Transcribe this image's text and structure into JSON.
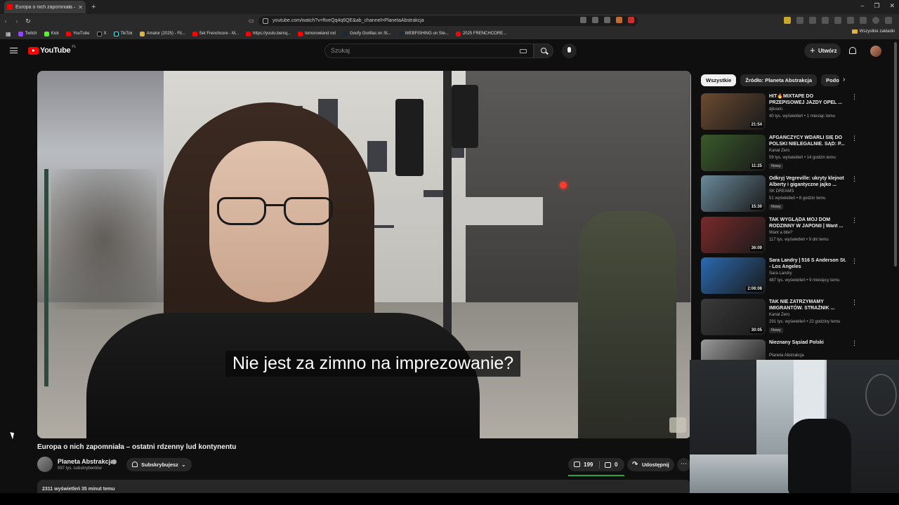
{
  "browser": {
    "tab_title": "Europa o nich zapomniała –",
    "url": "youtube.com/watch?v=ftveQq4q6QE&ab_channel=PlanetaAbstrakcja",
    "bookmarks": [
      "Twitch",
      "Kick",
      "YouTube",
      "X",
      "TikTok",
      "Amator (2025) - Fil...",
      "Set Frenchcore - M...",
      "https://youtu.be/xq...",
      "tomorowland nxt",
      "Goofy Gorillas on St...",
      "WEBFISHING on Ste...",
      "2025 FRENCHCORE..."
    ],
    "bookmarks_folder": "Wszystkie zakładki"
  },
  "header": {
    "logo_text": "YouTube",
    "logo_country": "PL",
    "search_placeholder": "Szukaj",
    "create_label": "Utwórz"
  },
  "video": {
    "subtitle": "Nie jest za zimno na imprezowanie?",
    "title": "Europa o nich zapomniała – ostatni rdzenny lud kontynentu",
    "channel_name": "Planeta Abstrakcja",
    "channel_subs": "597 tys. subskrybentów",
    "subscribe_label": "Subskrybujesz",
    "likes": "199",
    "dislikes": "0",
    "like_ratio": 1.0,
    "share_label": "Udostępnij",
    "description_preview": "2311 wyświetleń  35 minut temu"
  },
  "sidebar": {
    "chips": [
      "Wszystkie",
      "Źródło: Planeta Abstrakcja",
      "Podob"
    ],
    "recommendations": [
      {
        "title": "HIT🔥MIXTAPE DO PRZEPISOWEJ JAZDY OPEL ...",
        "channel": "djlusen",
        "meta": "40 tys. wyświetleń • 1 miesiąc temu",
        "duration": "21:54",
        "thumb": "#6b4a30",
        "badge": ""
      },
      {
        "title": "AFGAŃCZYCY WDARLI SIĘ DO POLSKI NIELEGALNIE. SĄD: P...",
        "channel": "Kanał Zero",
        "meta": "59 tys. wyświetleń • 14 godzin temu",
        "duration": "11:25",
        "thumb": "#3a5a2a",
        "badge": "Nowy"
      },
      {
        "title": "Odkryj Vegreville: ukryty klejnot Alberty i gigantyczne jajko ...",
        "channel": "SK DREAMS",
        "meta": "51 wyświetleń • 8 godzin temu",
        "duration": "15:30",
        "thumb": "#6a8a9a",
        "badge": "Nowy"
      },
      {
        "title": "TAK WYGLĄDA MÓJ DOM RODZINNY W JAPONII | Want ...",
        "channel": "Want a bite?",
        "meta": "117 tys. wyświetleń • 9 dni temu",
        "duration": "36:09",
        "thumb": "#7a2a2a",
        "badge": ""
      },
      {
        "title": "Sara Landry | 516 S Anderson St. - Los Angeles",
        "channel": "Sara Landry",
        "meta": "487 tys. wyświetleń • 9 miesięcy temu",
        "duration": "2:06:08",
        "thumb": "#2a6ab0",
        "badge": ""
      },
      {
        "title": "TAK NIE ZATRZYMAMY IMIGRANTÓW. STRAŻNIK ...",
        "channel": "Kanał Zero",
        "meta": "291 tys. wyświetleń • 22 godziny temu",
        "duration": "30:05",
        "thumb": "#3a3a3a",
        "badge": "Nowy"
      },
      {
        "title": "Nieznany Sąsiad Polski",
        "channel": "Planeta Abstrakcja",
        "meta": "609 tys. wyświetleń • 2 miesiące temu",
        "duration": "",
        "thumb": "#9a9a9a",
        "badge": ""
      }
    ]
  },
  "colors": {
    "accent": "#ff0000",
    "like_bar": "#2ba640",
    "background": "#0f0f0f"
  }
}
